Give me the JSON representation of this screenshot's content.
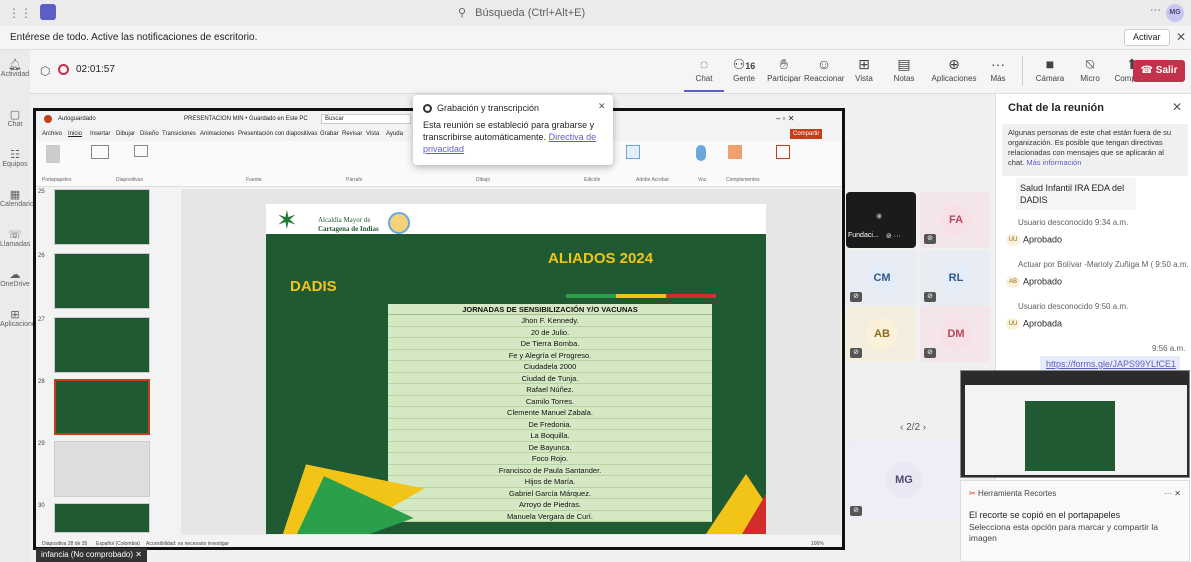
{
  "titlebar": {
    "search_placeholder": "Búsqueda (Ctrl+Alt+E)",
    "more": "···",
    "user_initials": "MG"
  },
  "notification": {
    "text": "Entérese de todo. Active las notificaciones de escritorio.",
    "button": "Activar"
  },
  "left_rail": [
    "Actividad",
    "Chat",
    "Equipos",
    "Calendario",
    "Llamadas",
    "OneDrive",
    "Aplicaciones"
  ],
  "meeting": {
    "timer": "02:01:57",
    "tools": [
      {
        "label": "Chat",
        "icon": "chat-icon"
      },
      {
        "label": "Gente",
        "badge": "16",
        "icon": "people-icon"
      },
      {
        "label": "Participar",
        "icon": "hand-icon"
      },
      {
        "label": "Reaccionar",
        "icon": "smile-icon"
      },
      {
        "label": "Vista",
        "icon": "grid-icon"
      },
      {
        "label": "Notas",
        "icon": "notes-icon"
      },
      {
        "label": "Aplicaciones",
        "icon": "plus-icon"
      },
      {
        "label": "Más",
        "icon": "more-icon"
      },
      {
        "label": "Cámara",
        "icon": "camera-off-icon"
      },
      {
        "label": "Micro",
        "icon": "mic-off-icon"
      },
      {
        "label": "Compartir",
        "icon": "share-icon"
      }
    ],
    "leave": "Salir"
  },
  "powerpoint": {
    "title": "PRESENTACION MIN • Guardado en Este PC",
    "search": "Buscar",
    "menus": [
      "Archivo",
      "Inicio",
      "Insertar",
      "Dibujar",
      "Diseño",
      "Transiciones",
      "Animaciones",
      "Presentación con diapositivas",
      "Grabar",
      "Revisar",
      "Vista",
      "Ayuda"
    ],
    "ribbon_groups": [
      "Portapapeles",
      "Diapositivas",
      "Fuente",
      "Párrafo",
      "Dibujo",
      "Edición",
      "Adobe Acrobat",
      "Voz",
      "Complementos"
    ],
    "thumb_numbers": [
      "25",
      "26",
      "27",
      "28",
      "29",
      "30"
    ],
    "status": "Diapositiva 28 de 35",
    "language": "Español (Colombia)",
    "accessibility": "Accesibilidad: es necesario investigar",
    "zoom": "106%"
  },
  "slide": {
    "logo_text_1": "Alcaldía Mayor de",
    "logo_text_2": "Cartagena de Indias",
    "title": "ALIADOS 2024",
    "org": "DADIS",
    "table_header": "JORNADAS DE SENSIBILIZACIÓN  Y/O VACUNAS",
    "rows": [
      "Jhon F. Kennedy.",
      "20 de Julio.",
      "De Tierra Bomba.",
      "Fe y Alegría el Progreso.",
      "Ciudadela 2000",
      "Ciudad de Tunja.",
      "Rafael Núñez.",
      "Camilo Torres.",
      "Clemente Manuel Zabala.",
      "De Fredonia.",
      "La Boquilla.",
      "De Bayunca.",
      "Foco Rojo.",
      "Francisco de Paula Santander.",
      "Hijos de María.",
      "Gabriel García Márquez.",
      "Arroyo de Piedras.",
      "Manuela Vergara de Curí."
    ]
  },
  "popup": {
    "title": "Grabación y transcripción",
    "text": "Esta reunión se estableció para grabarse y transcribirse automáticamente.",
    "link": "Directiva de privacidad"
  },
  "presenter_label": "infancia (No comprobado)",
  "participants": [
    {
      "initials": "",
      "label": "Fundaci...",
      "bg": "#1b1b1b",
      "fg": "#ffffff"
    },
    {
      "initials": "FA",
      "bg": "#f7e1e6",
      "fg": "#b5475b"
    },
    {
      "initials": "CM",
      "bg": "#e3ecf7",
      "fg": "#2f5b8a"
    },
    {
      "initials": "RL",
      "bg": "#e3ecf7",
      "fg": "#2f5b8a"
    },
    {
      "initials": "AB",
      "bg": "#fbf1d9",
      "fg": "#8a6a1d"
    },
    {
      "initials": "DM",
      "bg": "#f7e1e6",
      "fg": "#b5475b"
    },
    {
      "initials": "MG",
      "bg": "#eae6f3",
      "fg": "#4c4a73"
    }
  ],
  "pager": "2/2",
  "chat": {
    "title": "Chat de la reunión",
    "notice": "Algunas personas de este chat están fuera de su organización. Es posible que tengan directivas relacionadas con mensajes que se aplicarán al chat.",
    "notice_link": "Más información",
    "messages": [
      {
        "meta": "",
        "text": "Salud Infantil IRA EDA del DADIS"
      },
      {
        "meta": "Usuario desconocido  9:34 a.m.",
        "avatar": "UU",
        "text": "Aprobado"
      },
      {
        "meta": "Actuar por Bolívar -Mariolу Zuñiga M (  9:50 a.m.",
        "avatar": "AB",
        "text": "Aprobado"
      },
      {
        "meta": "Usuario desconocido  9:50 a.m.",
        "avatar": "UU",
        "text": "Aprobada"
      }
    ],
    "own_time": "9:56 a.m.",
    "own_link": "https://forms.gle/JAPS99YLfCE1"
  },
  "snip": {
    "app": "Herramienta Recortes",
    "title": "El recorte se copió en el portapapeles",
    "text": "Selecciona esta opción para marcar y compartir la imagen"
  },
  "colors": {
    "leave": "#c4314b",
    "accent": "#5b5fc7",
    "slide_green": "#1f5a32"
  }
}
